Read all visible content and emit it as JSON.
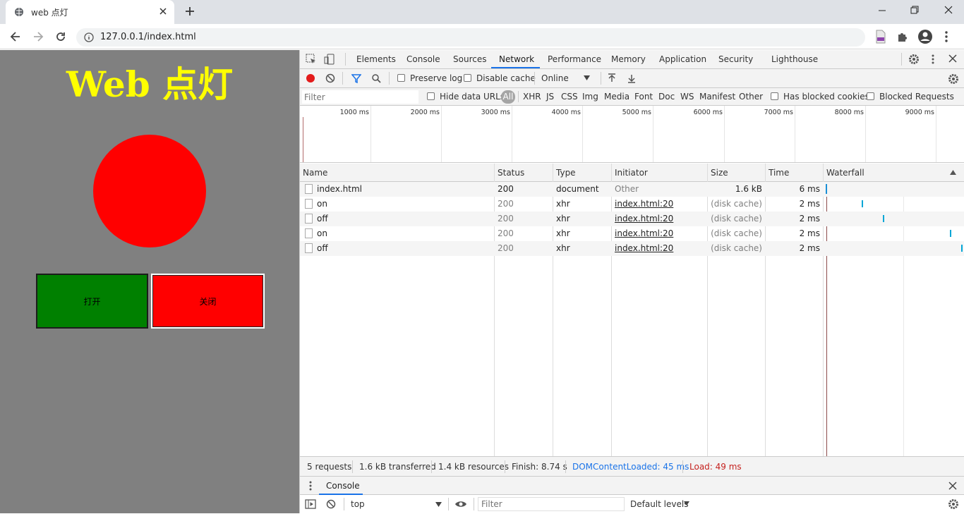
{
  "browser": {
    "tab_title": "web 点灯",
    "url": "127.0.0.1/index.html"
  },
  "page": {
    "heading": "Web 点灯",
    "lamp_color": "#ff0000",
    "on_button": "打开",
    "off_button": "关闭",
    "on_button_color": "#008000",
    "off_button_color": "#ff0000"
  },
  "devtools": {
    "tabs": [
      "Elements",
      "Console",
      "Sources",
      "Network",
      "Performance",
      "Memory",
      "Application",
      "Security",
      "Lighthouse"
    ],
    "selected_tab": "Network",
    "toolbar": {
      "preserve_log": "Preserve log",
      "disable_cache": "Disable cache",
      "throttling": "Online"
    },
    "filter": {
      "placeholder": "Filter",
      "hide_data_urls": "Hide data URLs",
      "types": [
        "All",
        "XHR",
        "JS",
        "CSS",
        "Img",
        "Media",
        "Font",
        "Doc",
        "WS",
        "Manifest",
        "Other"
      ],
      "selected_type": "All",
      "has_blocked_cookies": "Has blocked cookies",
      "blocked_requests": "Blocked Requests"
    },
    "timeline_ticks": [
      "1000 ms",
      "2000 ms",
      "3000 ms",
      "4000 ms",
      "5000 ms",
      "6000 ms",
      "7000 ms",
      "8000 ms",
      "9000 ms"
    ],
    "columns": [
      "Name",
      "Status",
      "Type",
      "Initiator",
      "Size",
      "Time",
      "Waterfall"
    ],
    "requests": [
      {
        "name": "index.html",
        "status": "200",
        "type": "document",
        "initiator": "Other",
        "size": "1.6 kB",
        "time": "6 ms"
      },
      {
        "name": "on",
        "status": "200",
        "type": "xhr",
        "initiator": "index.html:20",
        "size": "(disk cache)",
        "time": "2 ms"
      },
      {
        "name": "off",
        "status": "200",
        "type": "xhr",
        "initiator": "index.html:20",
        "size": "(disk cache)",
        "time": "2 ms"
      },
      {
        "name": "on",
        "status": "200",
        "type": "xhr",
        "initiator": "index.html:20",
        "size": "(disk cache)",
        "time": "2 ms"
      },
      {
        "name": "off",
        "status": "200",
        "type": "xhr",
        "initiator": "index.html:20",
        "size": "(disk cache)",
        "time": "2 ms"
      }
    ],
    "status": {
      "requests": "5 requests",
      "transferred": "1.6 kB transferred",
      "resources": "1.4 kB resources",
      "finish": "Finish: 8.74 s",
      "dcl": "DOMContentLoaded: 45 ms",
      "load": "Load: 49 ms",
      "dcl_color": "#1a73e8",
      "load_color": "#c5221f"
    },
    "drawer": {
      "tab": "Console",
      "context": "top",
      "filter_placeholder": "Filter",
      "levels": "Default levels"
    }
  }
}
